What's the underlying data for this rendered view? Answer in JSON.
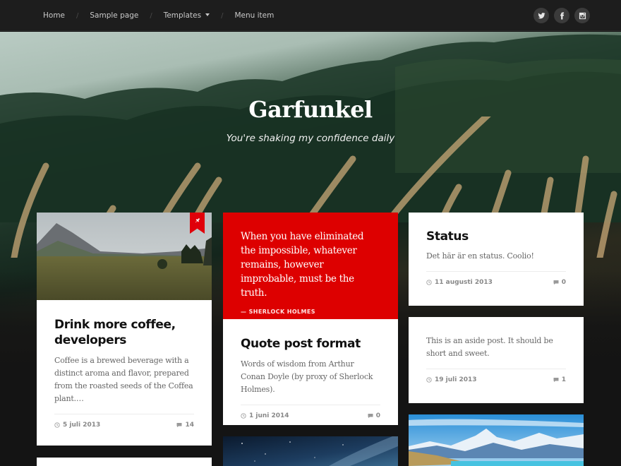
{
  "nav": {
    "items": [
      {
        "label": "Home"
      },
      {
        "label": "Sample page"
      },
      {
        "label": "Templates",
        "has_dropdown": true
      },
      {
        "label": "Menu item"
      }
    ],
    "separator": "/"
  },
  "social": [
    {
      "name": "twitter",
      "icon": "twitter-icon"
    },
    {
      "name": "facebook",
      "icon": "facebook-icon"
    },
    {
      "name": "instagram",
      "icon": "instagram-icon"
    }
  ],
  "header": {
    "title": "Garfunkel",
    "description": "You're shaking my confidence daily"
  },
  "colors": {
    "accent": "#dd0000",
    "topbar": "#1d1d1d",
    "background": "#141414"
  },
  "posts": [
    {
      "type": "standard",
      "sticky": true,
      "image": "mountain-valley-photo",
      "title": "Drink more coffee, developers",
      "excerpt": "Coffee is a brewed beverage with a distinct aroma and flavor, prepared from the roasted seeds of the Coffea plant.…",
      "date": "5 juli 2013",
      "comments": "14"
    },
    {
      "type": "quote",
      "quote": "When you have eliminated the impossible, whatever remains, however improbable, must be the truth.",
      "cite": "— SHERLOCK HOLMES",
      "title": "Quote post format",
      "excerpt": "Words of wisdom from Arthur Conan Doyle (by proxy of Sherlock Holmes).",
      "date": "1 juni 2014",
      "comments": "0"
    },
    {
      "type": "status",
      "title": "Status",
      "excerpt": "Det här är en status. Coolio!",
      "date": "11 augusti 2013",
      "comments": "0"
    },
    {
      "type": "aside",
      "excerpt": "This is an aside post. It should be short and sweet.",
      "date": "19 juli 2013",
      "comments": "1"
    },
    {
      "type": "image",
      "image": "starry-sky-photo"
    },
    {
      "type": "image",
      "image": "snowy-mountain-lake-photo"
    }
  ]
}
